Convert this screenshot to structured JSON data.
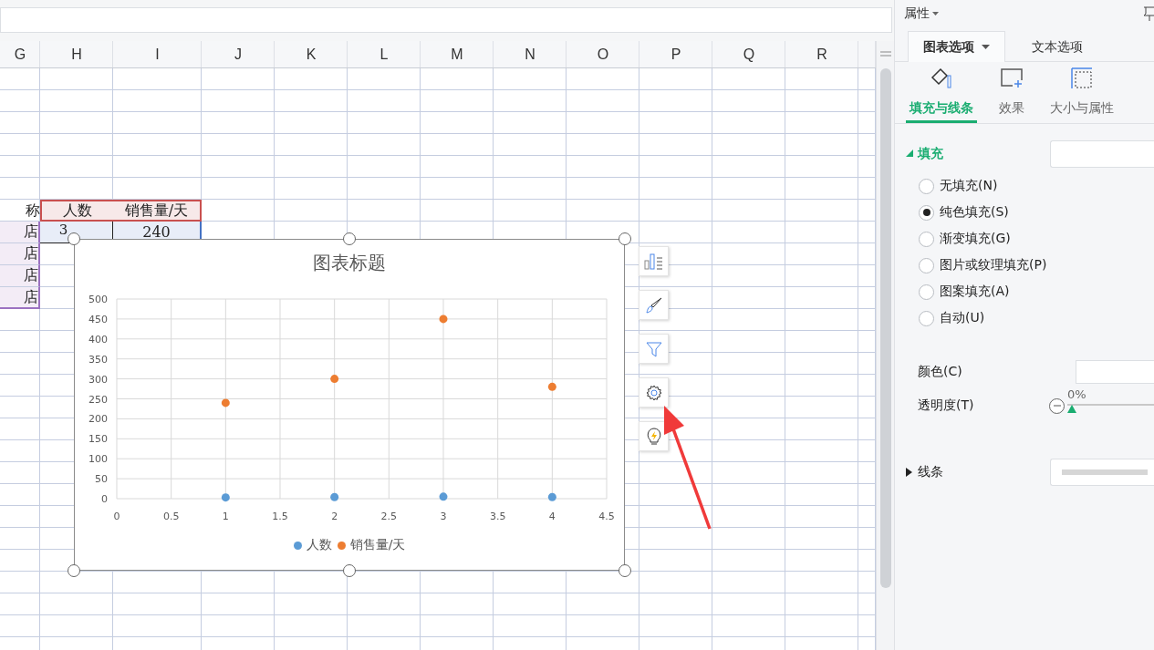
{
  "sheet": {
    "columns": [
      "G",
      "H",
      "I",
      "J",
      "K",
      "L",
      "M",
      "N",
      "O",
      "P",
      "Q",
      "R"
    ],
    "table": {
      "header": [
        "称",
        "人数",
        "销售量/天"
      ],
      "rows": [
        [
          "店",
          "3",
          "240"
        ],
        [
          "店"
        ],
        [
          "店"
        ],
        [
          "店"
        ]
      ]
    },
    "chart": {
      "chart_data": {
        "type": "scatter",
        "title": "图表标题",
        "grid": true,
        "legend": true,
        "x": [
          1,
          2,
          3,
          4
        ],
        "xlim": [
          0,
          4.5
        ],
        "ylim": [
          0,
          500
        ],
        "xticks": [
          0,
          {
            "value": 0.5,
            "label": "0.5"
          },
          1,
          {
            "value": 1.5,
            "label": "1.5"
          },
          2,
          {
            "value": 2.5,
            "label": "2.5"
          },
          3,
          {
            "value": 3.5,
            "label": "3.5"
          },
          4,
          {
            "value": 4.5,
            "label": "4.5"
          }
        ],
        "yticks": [
          0,
          50,
          100,
          150,
          200,
          250,
          300,
          350,
          400,
          450,
          500
        ],
        "series": [
          {
            "name": "人数",
            "color": "#5b9bd5",
            "values": [
              3,
              4,
              5,
              4
            ]
          },
          {
            "name": "销售量/天",
            "color": "#ed7d31",
            "values": [
              240,
              300,
              450,
              280
            ]
          }
        ]
      }
    }
  },
  "panel": {
    "title": "属性",
    "tabs": [
      {
        "label": "图表选项",
        "selected": true
      },
      {
        "label": "文本选项",
        "selected": false
      }
    ],
    "subtabs": [
      {
        "label": "填充与线条",
        "selected": true
      },
      {
        "label": "效果",
        "selected": false
      },
      {
        "label": "大小与属性",
        "selected": false
      }
    ],
    "fill": {
      "title": "填充",
      "expanded": true,
      "options": [
        {
          "label": "无填充(N)",
          "selected": false
        },
        {
          "label": "纯色填充(S)",
          "selected": true
        },
        {
          "label": "渐变填充(G)",
          "selected": false
        },
        {
          "label": "图片或纹理填充(P)",
          "selected": false
        },
        {
          "label": "图案填充(A)",
          "selected": false
        },
        {
          "label": "自动(U)",
          "selected": false
        }
      ],
      "color_label": "颜色(C)",
      "transparency": {
        "label": "透明度(T)",
        "reading": "0%",
        "level": 0
      }
    },
    "line": {
      "title": "线条",
      "expanded": false
    }
  }
}
